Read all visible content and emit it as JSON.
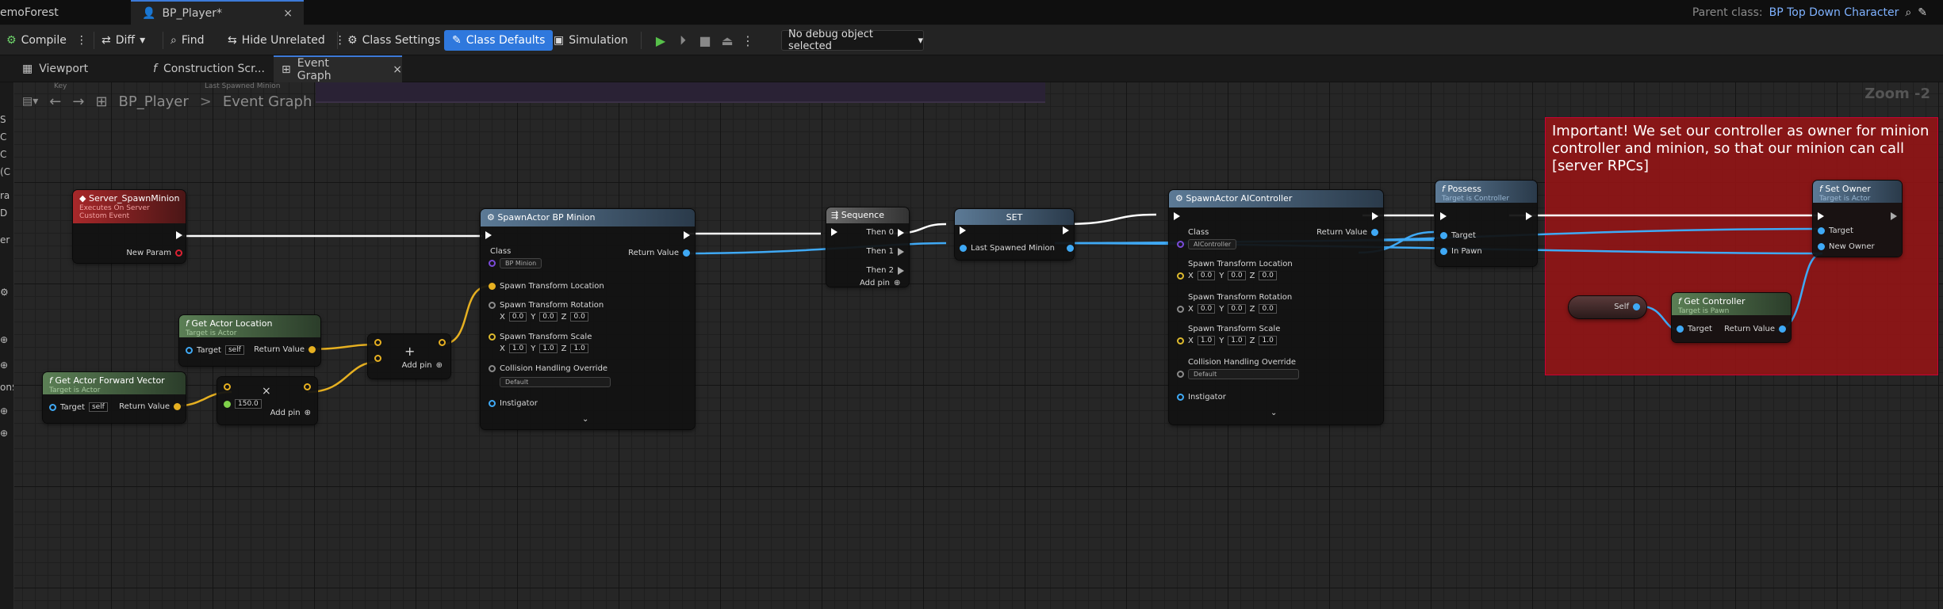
{
  "titlebar": {
    "project_tab": "emoForest",
    "bp_tab": "BP_Player*",
    "close": "×",
    "parent_class_label": "Parent class:",
    "parent_class_value": "BP Top Down Character"
  },
  "toolbar": {
    "compile": "Compile",
    "diff": "Diff",
    "find": "Find",
    "hide_unrelated": "Hide Unrelated",
    "class_settings": "Class Settings",
    "class_defaults": "Class Defaults",
    "simulation": "Simulation",
    "debug_object": "No debug object selected"
  },
  "tabs": {
    "viewport": "Viewport",
    "construction": "Construction Scr...",
    "event_graph": "Event Graph"
  },
  "breadcrumb": {
    "bp": "BP_Player",
    "graph": "Event Graph",
    "sep": ">"
  },
  "zoom": "Zoom -2",
  "left_panel": [
    "S",
    "C",
    "C",
    "(C",
    "ra",
    "D",
    "er",
    "on$"
  ],
  "top_comment": {
    "key": "Key",
    "last_spawned": "Last Spawned Minion"
  },
  "comment": {
    "text": "Important! We set our controller as owner for minion controller and minion, so that our minion can call [server RPCs]"
  },
  "nodes": {
    "server_spawn": {
      "title": "Server_SpawnMinion",
      "sub1": "Executes On Server",
      "sub2": "Custom Event",
      "pin": "New Param"
    },
    "get_actor_location": {
      "title": "Get Actor Location",
      "sub": "Target is Actor",
      "target": "Target",
      "self": "self",
      "ret": "Return Value"
    },
    "get_forward": {
      "title": "Get Actor Forward Vector",
      "sub": "Target is Actor",
      "target": "Target",
      "self": "self",
      "ret": "Return Value"
    },
    "add1": {
      "add_pin": "Add pin",
      "sym": "+"
    },
    "mult": {
      "val": "150.0",
      "add_pin": "Add pin",
      "sym": "×"
    },
    "spawn_minion": {
      "title": "SpawnActor BP Minion",
      "class": "Class",
      "class_val": "BP Minion",
      "ret": "Return Value",
      "loc": "Spawn Transform Location",
      "rot": "Spawn Transform Rotation",
      "scale": "Spawn Transform Scale",
      "x": "X",
      "y": "Y",
      "z": "Z",
      "rot_x": "0.0",
      "rot_y": "0.0",
      "rot_z": "0.0",
      "sc_x": "1.0",
      "sc_y": "1.0",
      "sc_z": "1.0",
      "coll": "Collision Handling Override",
      "coll_val": "Default",
      "inst": "Instigator"
    },
    "sequence": {
      "title": "Sequence",
      "then0": "Then 0",
      "then1": "Then 1",
      "then2": "Then 2",
      "add_pin": "Add pin"
    },
    "set": {
      "title": "SET",
      "pin": "Last Spawned Minion"
    },
    "spawn_ai": {
      "title": "SpawnActor AIController",
      "class": "Class",
      "class_val": "AIController",
      "ret": "Return Value",
      "loc": "Spawn Transform Location",
      "rot": "Spawn Transform Rotation",
      "scale": "Spawn Transform Scale",
      "x": "X",
      "y": "Y",
      "z": "Z",
      "loc_x": "0.0",
      "loc_y": "0.0",
      "loc_z": "0.0",
      "rot_x": "0.0",
      "rot_y": "0.0",
      "rot_z": "0.0",
      "sc_x": "1.0",
      "sc_y": "1.0",
      "sc_z": "1.0",
      "coll": "Collision Handling Override",
      "coll_val": "Default",
      "inst": "Instigator"
    },
    "possess": {
      "title": "Possess",
      "sub": "Target is Controller",
      "target": "Target",
      "inpawn": "In Pawn"
    },
    "set_owner": {
      "title": "Set Owner",
      "sub": "Target is Actor",
      "target": "Target",
      "new_owner": "New Owner"
    },
    "self_node": {
      "label": "Self"
    },
    "get_controller": {
      "title": "Get Controller",
      "sub": "Target is Pawn",
      "target": "Target",
      "ret": "Return Value"
    }
  },
  "colors": {
    "accent": "#2f78dd",
    "exec_wire": "#ffffff",
    "object_wire": "#3fa9f5",
    "vector_wire": "#e6b021",
    "comment_red": "#961416"
  }
}
